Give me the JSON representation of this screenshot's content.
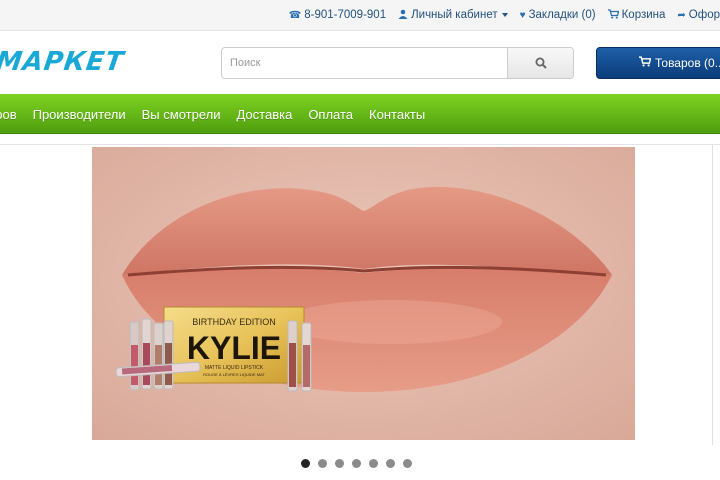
{
  "topbar": {
    "phone": "8-901-7009-901",
    "account_label": "Личный кабинет",
    "bookmarks_label": "Закладки (0)",
    "cart_label": "Корзина",
    "checkout_label": "Офор"
  },
  "header": {
    "logo_text": "МАРКЕТ",
    "search_placeholder": "Поиск",
    "cart_button_label": "Товаров (0..."
  },
  "menu": {
    "items": [
      "аров",
      "Производители",
      "Вы смотрели",
      "Доставка",
      "Оплата",
      "Контакты"
    ]
  },
  "banner": {
    "product_title": "KYLIE",
    "product_subtitle": "BIRTHDAY EDITION",
    "product_small_text": "MATTE LIQUID LIPSTICK",
    "product_tiny_text": "ROUGE À LÈVRES LIQUIDE MAT"
  },
  "carousel": {
    "slide_count": 7,
    "active_index": 0
  },
  "colors": {
    "menu_green": "#6cc21a",
    "accent_blue": "#1aa9d6",
    "cart_blue": "#0f4a8f"
  },
  "icons": {
    "phone": "phone-icon",
    "user": "user-icon",
    "heart": "heart-icon",
    "cart": "cart-icon",
    "share": "share-icon",
    "search": "search-icon"
  }
}
